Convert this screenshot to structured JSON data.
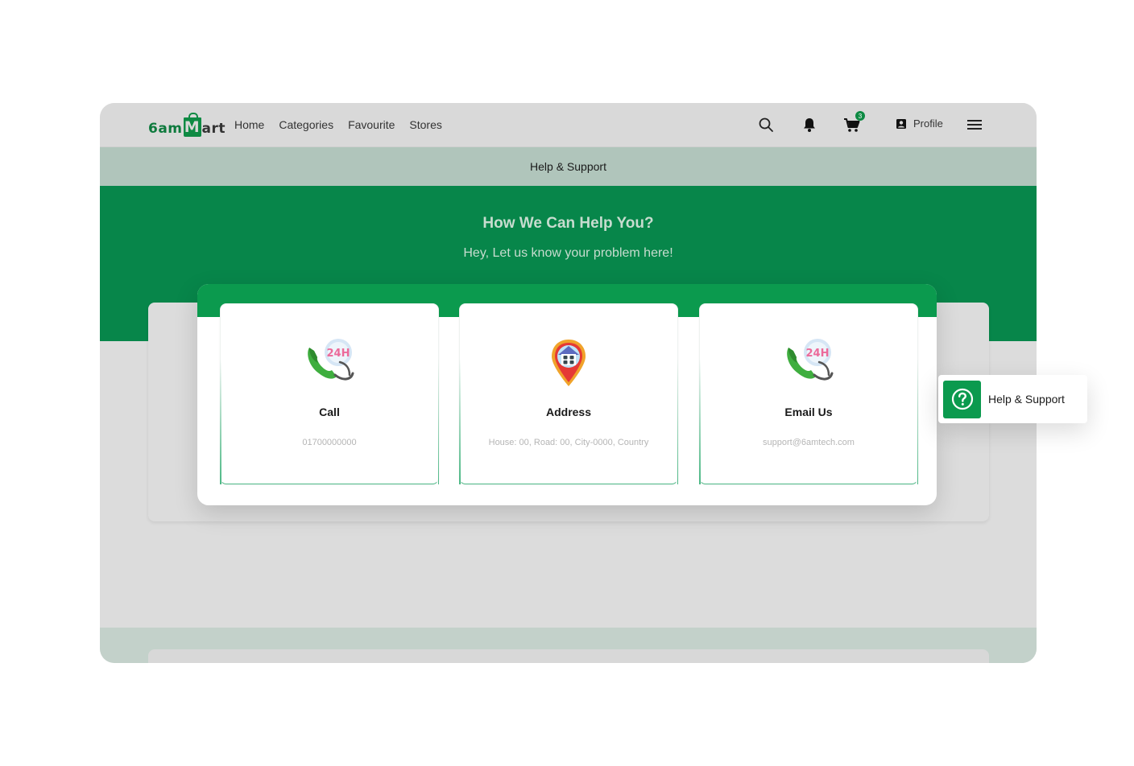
{
  "nav": {
    "logo": {
      "part1": "6am",
      "part2": "M",
      "part3": "art"
    },
    "links": [
      "Home",
      "Categories",
      "Favourite",
      "Stores"
    ],
    "cart_count": "3",
    "profile_label": "Profile",
    "icons": [
      "search-icon",
      "bell-icon",
      "cart-icon",
      "profile-icon",
      "menu-icon"
    ]
  },
  "subheader": {
    "title": "Help & Support"
  },
  "hero": {
    "title": "How We Can Help You?",
    "subtitle": "Hey, Let us know your problem here!"
  },
  "cards": [
    {
      "title": "Call",
      "value": "01700000000",
      "icon": "phone-24h-icon"
    },
    {
      "title": "Address",
      "value": "House: 00, Road: 00, City-0000, Country",
      "icon": "location-pin-icon"
    },
    {
      "title": "Email Us",
      "value": "support@6amtech.com",
      "icon": "phone-24h-icon"
    }
  ],
  "floating": {
    "label": "Help & Support",
    "icon": "question-icon"
  },
  "colors": {
    "primary": "#0b9a4e",
    "hero": "#07864a",
    "subheader": "#b0c5bb",
    "nav": "#d9d9d9"
  }
}
